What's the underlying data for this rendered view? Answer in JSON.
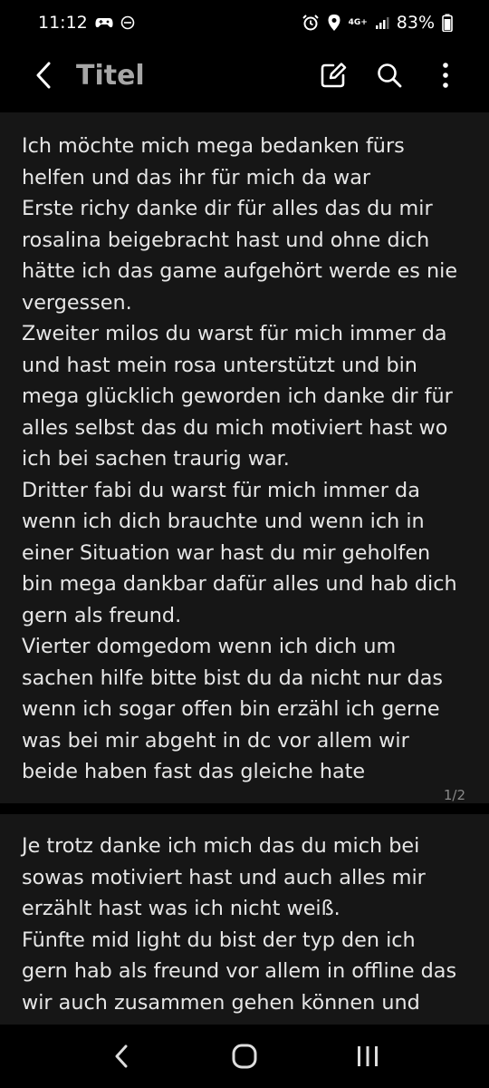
{
  "status_bar": {
    "time": "11:12",
    "network": "4G+",
    "battery": "83%",
    "icons_left": [
      "game-controller-icon",
      "do-not-disturb-icon"
    ],
    "icons_right": [
      "alarm-icon",
      "location-icon",
      "signal-icon",
      "battery-icon"
    ]
  },
  "app_bar": {
    "title": "Titel",
    "actions": [
      "edit-icon",
      "search-icon",
      "more-vert-icon"
    ]
  },
  "note": {
    "page1_text": "Ich möchte mich mega bedanken fürs\nhelfen und das ihr für mich da war\nErste richy danke dir für alles das du mir\nrosalina beigebracht hast und ohne dich\nhätte ich das game aufgehört werde es nie\nvergessen.\nZweiter milos du warst für mich immer da\nund hast mein rosa unterstützt und bin\nmega glücklich geworden ich danke dir für\nalles selbst das du mich motiviert hast wo\nich bei sachen traurig war.\nDritter fabi du warst für mich immer da\nwenn ich dich brauchte und wenn ich in\neiner Situation war hast du mir geholfen\nbin mega dankbar dafür alles und hab dich\ngern als freund.\nVierter domgedom wenn ich dich um\nsachen hilfe bitte bist du da nicht nur das\nwenn ich sogar offen bin erzähl ich gerne\nwas bei mir abgeht in dc vor allem wir\nbeide haben fast das gleiche hate",
    "page_indicator": "1/2",
    "page2_text": "Je trotz danke ich mich das du mich bei\nsowas motiviert hast und auch alles mir\nerzählt hast was ich nicht weiß.\nFünfte mid light du bist der typ den ich\ngern hab als freund vor allem in offline das\nwir auch zusammen gehen können und"
  },
  "nav_bar": {
    "buttons": [
      "back-nav-icon",
      "home-icon",
      "recent-apps-icon"
    ]
  }
}
